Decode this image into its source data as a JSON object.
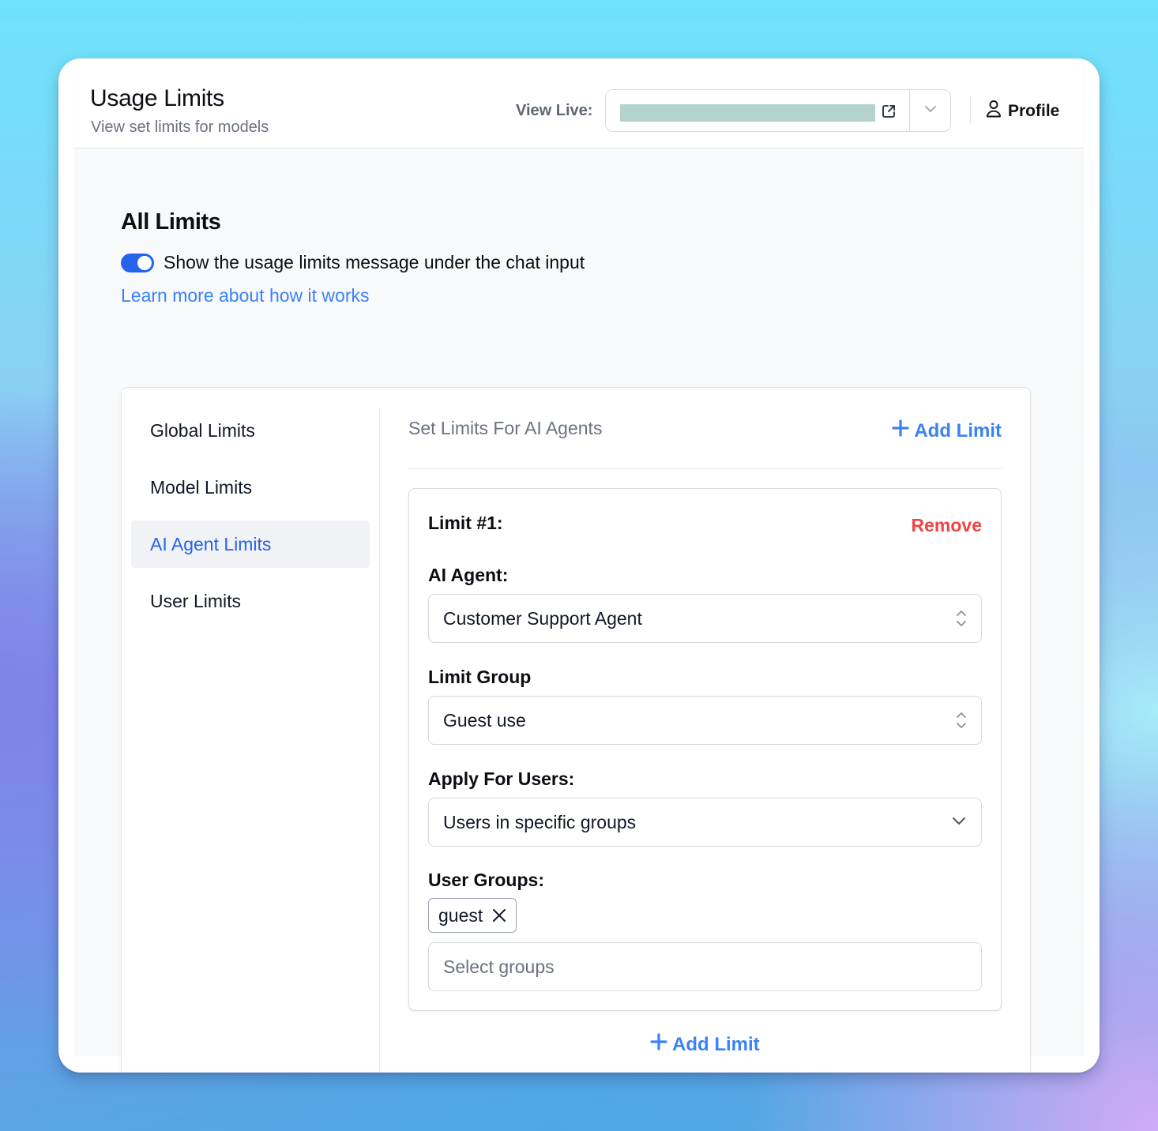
{
  "header": {
    "title": "Usage Limits",
    "subtitle": "View set limits for models",
    "view_live_label": "View Live:",
    "view_live_url_redacted": true,
    "open_external_icon": "external-link-icon",
    "dropdown_icon": "chevron-down-icon",
    "profile_label": "Profile",
    "profile_icon": "user-icon"
  },
  "section": {
    "title": "All Limits",
    "toggle": {
      "label": "Show the usage limits message under the chat input",
      "enabled": true
    },
    "learn_more_link": "Learn more about how it works"
  },
  "sidebar": {
    "items": [
      {
        "label": "Global Limits",
        "active": false
      },
      {
        "label": "Model Limits",
        "active": false
      },
      {
        "label": "AI Agent Limits",
        "active": true
      },
      {
        "label": "User Limits",
        "active": false
      }
    ]
  },
  "panel": {
    "title": "Set Limits For AI Agents",
    "add_limit_label": "Add Limit",
    "add_limit_bottom_label": "Add Limit",
    "limits": [
      {
        "title": "Limit #1:",
        "remove_label": "Remove",
        "fields": {
          "ai_agent": {
            "label": "AI Agent:",
            "value": "Customer Support Agent"
          },
          "limit_group": {
            "label": "Limit Group",
            "value": "Guest use"
          },
          "apply_for_users": {
            "label": "Apply For Users:",
            "value": "Users in specific groups"
          },
          "user_groups": {
            "label": "User Groups:",
            "selected": [
              "guest"
            ],
            "placeholder": "Select groups"
          }
        }
      }
    ]
  },
  "colors": {
    "accent": "#3b82f6",
    "toggle_on": "#2563eb",
    "danger": "#ef4444",
    "active_nav_bg": "#f1f2f5"
  }
}
